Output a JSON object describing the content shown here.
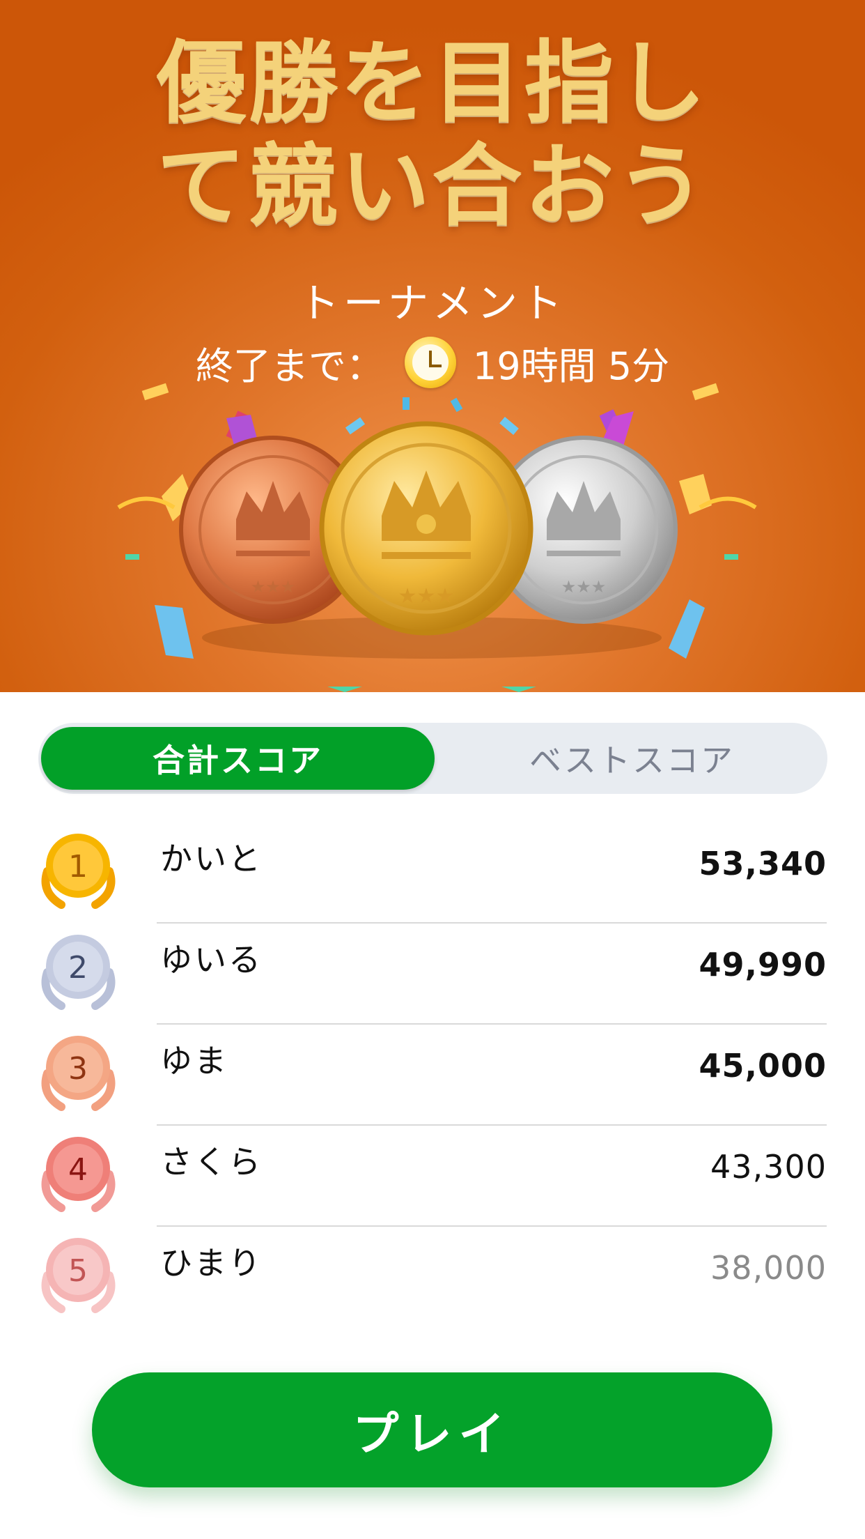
{
  "hero": {
    "headline_line1": "優勝を目指し",
    "headline_line2": "て競い合おう",
    "subtitle": "トーナメント",
    "timer_label": "終了まで：",
    "timer_value": "19時間 5分"
  },
  "tabs": {
    "total_score": "合計スコア",
    "best_score": "ベストスコア"
  },
  "leaderboard": [
    {
      "rank": "1",
      "name": "かいと",
      "score": "53,340"
    },
    {
      "rank": "2",
      "name": "ゆいる",
      "score": "49,990"
    },
    {
      "rank": "3",
      "name": "ゆま",
      "score": "45,000"
    },
    {
      "rank": "4",
      "name": "さくら",
      "score": "43,300"
    },
    {
      "rank": "5",
      "name": "ひまり",
      "score": "38,000"
    }
  ],
  "play_button": "プレイ",
  "colors": {
    "accent_green": "#02a028",
    "hero_orange": "#d2600f",
    "headline_gold": "#f4d27a"
  }
}
